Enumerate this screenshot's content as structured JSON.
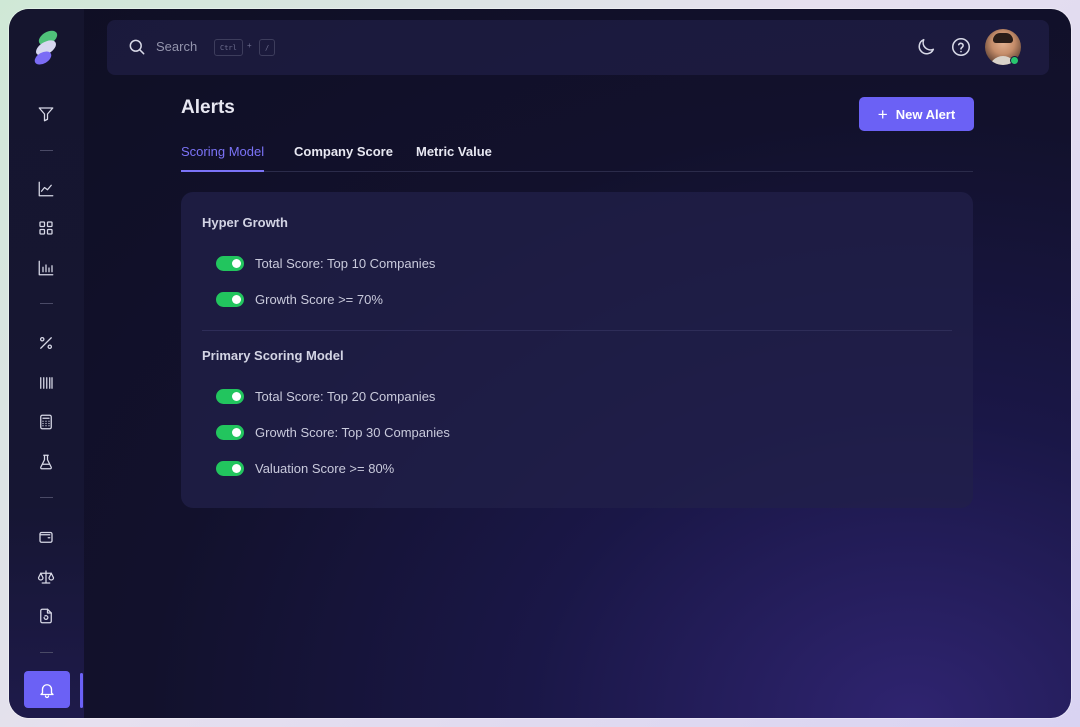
{
  "topbar": {
    "search_label": "Search",
    "shortcut_key1": "Ctrl",
    "shortcut_plus": "+",
    "shortcut_key2": "/"
  },
  "page": {
    "title": "Alerts",
    "new_alert_label": "New Alert"
  },
  "tabs": [
    {
      "label": "Scoring Model",
      "active": true
    },
    {
      "label": "Company Score",
      "active": false
    },
    {
      "label": "Metric Value",
      "active": false
    }
  ],
  "groups": [
    {
      "title": "Hyper Growth",
      "alerts": [
        {
          "label": "Total Score: Top 10 Companies",
          "enabled": true
        },
        {
          "label": "Growth Score >= 70%",
          "enabled": true
        }
      ]
    },
    {
      "title": "Primary Scoring Model",
      "alerts": [
        {
          "label": "Total Score: Top 20 Companies",
          "enabled": true
        },
        {
          "label": "Growth Score: Top 30 Companies",
          "enabled": true
        },
        {
          "label": "Valuation Score >= 80%",
          "enabled": true
        }
      ]
    }
  ],
  "sidebar": {
    "icons": [
      "filter-icon",
      "line-chart-icon",
      "grid-icon",
      "bar-chart-icon",
      "percent-icon",
      "barcode-icon",
      "calculator-icon",
      "flask-icon",
      "wallet-icon",
      "scale-icon",
      "document-refresh-icon",
      "bell-icon"
    ],
    "active": "bell-icon"
  },
  "colors": {
    "accent": "#6b61f5",
    "toggle_on": "#22c55e",
    "online": "#28c76f"
  }
}
